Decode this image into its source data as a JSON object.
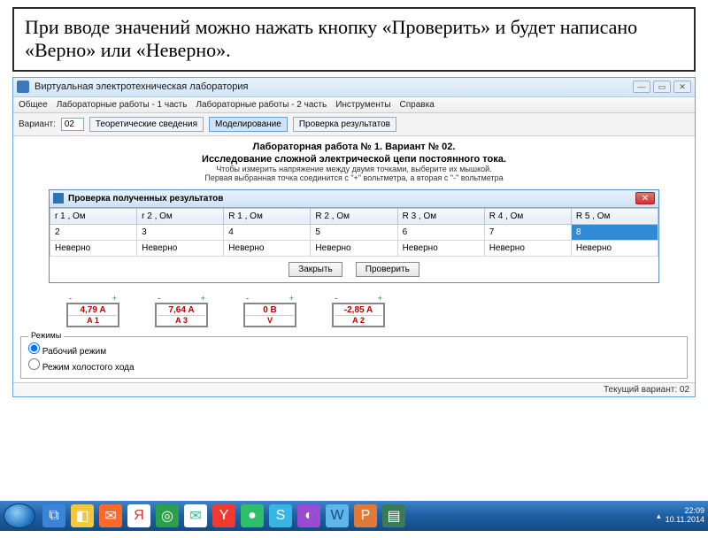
{
  "caption": "При вводе значений можно нажать кнопку «Проверить» и будет написано «Верно» или «Неверно».",
  "app": {
    "title": "Виртуальная электротехническая лаборатория",
    "menus": [
      "Общее",
      "Лабораторные работы - 1 часть",
      "Лабораторные работы - 2 часть",
      "Инструменты",
      "Справка"
    ],
    "toolbar": {
      "variant_label": "Вариант:",
      "variant_value": "02",
      "tab_theory": "Теоретические сведения",
      "tab_model": "Моделирование",
      "tab_results": "Проверка результатов"
    },
    "header": {
      "title": "Лабораторная работа № 1. Вариант № 02.",
      "subtitle": "Исследование сложной электрической цепи постоянного тока.",
      "hint1": "Чтобы измерить напряжение между двумя точками, выберите их мышкой.",
      "hint2": "Первая выбранная точка соединится с \"+\" вольтметра, а вторая с \"-\" вольтметра"
    },
    "status": "Текущий вариант: 02"
  },
  "dialog": {
    "title": "Проверка полученных результатов",
    "headers": [
      "r 1 , Ом",
      "r 2 , Ом",
      "R 1 , Ом",
      "R 2 , Ом",
      "R 3 , Ом",
      "R 4 , Ом",
      "R 5 , Ом"
    ],
    "row_values": [
      "2",
      "3",
      "4",
      "5",
      "6",
      "7",
      "8"
    ],
    "row_status": [
      "Неверно",
      "Неверно",
      "Неверно",
      "Неверно",
      "Неверно",
      "Неверно",
      "Неверно"
    ],
    "btn_close": "Закрыть",
    "btn_check": "Проверить"
  },
  "meters": [
    {
      "value": "4,79 A",
      "label": "A 1",
      "cls": "red"
    },
    {
      "value": "7,64 A",
      "label": "A 3",
      "cls": "red"
    },
    {
      "value": "0 В",
      "label": "V",
      "cls": "red"
    },
    {
      "value": "-2,85 A",
      "label": "A 2",
      "cls": "red"
    }
  ],
  "modes": {
    "legend": "Режимы",
    "opt1": "Рабочий режим",
    "opt2": "Режим холостого хода"
  },
  "tray": {
    "time": "22:09",
    "date": "10.11.2014"
  },
  "tb_icons": [
    {
      "bg": "#3a85d8",
      "g": "⧉"
    },
    {
      "bg": "#f5c73d",
      "g": "◧"
    },
    {
      "bg": "#ff6a2a",
      "g": "✉"
    },
    {
      "bg": "#ffffff",
      "g": "Я",
      "fg": "#d33"
    },
    {
      "bg": "#2aa04a",
      "g": "◎"
    },
    {
      "bg": "#ffffff",
      "g": "✉",
      "fg": "#3b8"
    },
    {
      "bg": "#f03a2f",
      "g": "Y"
    },
    {
      "bg": "#2fbf6a",
      "g": "●"
    },
    {
      "bg": "#37b6e6",
      "g": "S"
    },
    {
      "bg": "#9a4bd1",
      "g": "◐"
    },
    {
      "bg": "#5fb6e8",
      "g": "W",
      "fg": "#1a4e8a"
    },
    {
      "bg": "#e07a3a",
      "g": "P"
    },
    {
      "bg": "#3a7a5a",
      "g": "▤"
    }
  ]
}
